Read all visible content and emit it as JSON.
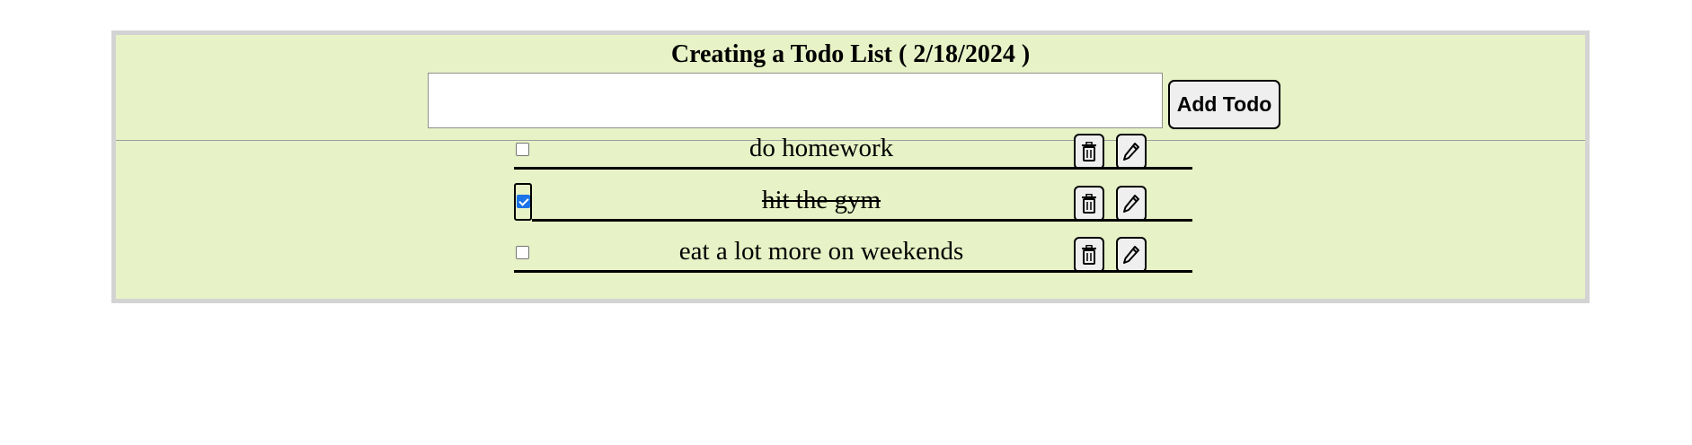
{
  "header": {
    "title": "Creating a Todo List ( 2/18/2024 )",
    "input_value": "",
    "input_placeholder": "",
    "add_label": "Add Todo"
  },
  "todos": [
    {
      "text": "do homework",
      "completed": false,
      "delete_icon": "trash-icon",
      "edit_icon": "pencil-icon"
    },
    {
      "text": "hit the gym",
      "completed": true,
      "delete_icon": "trash-icon",
      "edit_icon": "pencil-icon"
    },
    {
      "text": "eat a lot more on weekends",
      "completed": false,
      "delete_icon": "trash-icon",
      "edit_icon": "pencil-icon"
    }
  ],
  "colors": {
    "panel_background": "#e7f2c6",
    "panel_border": "#d3d3d3",
    "checkbox_accent": "#1a73e8"
  }
}
